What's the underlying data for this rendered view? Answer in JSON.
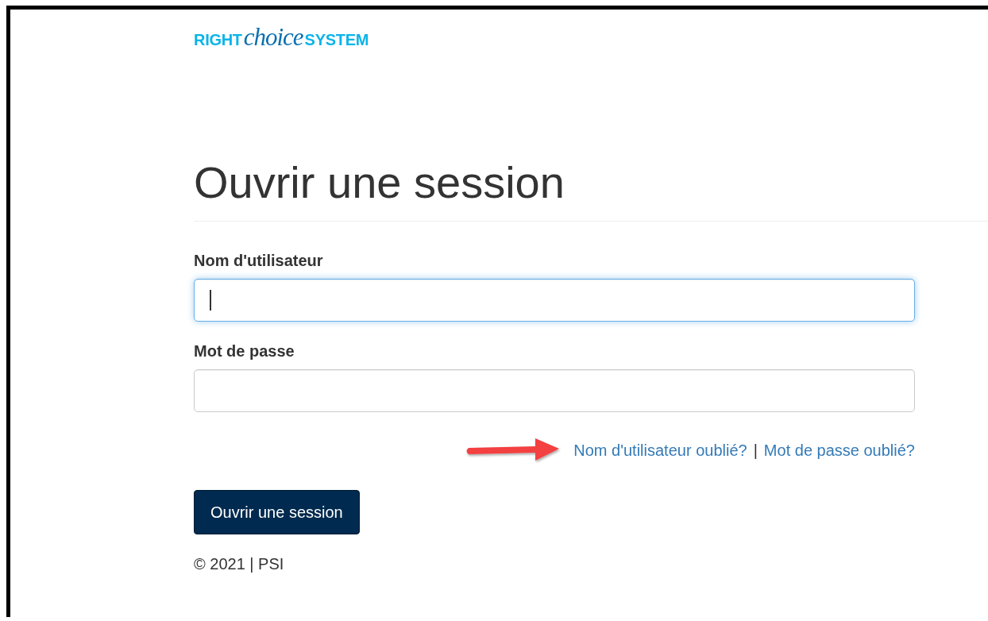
{
  "logo": {
    "part_1": "RIGHT",
    "part_2": "choice",
    "part_3": "SYSTEM"
  },
  "heading": "Ouvrir une session",
  "fields": [
    {
      "label": "Nom d'utilisateur",
      "focused": true
    },
    {
      "label": "Mot de passe",
      "focused": false
    }
  ],
  "links": [
    "Nom d'utilisateur oublié?",
    "Mot de passe oublié?"
  ],
  "link_separator": "|",
  "submit_button": "Ouvrir une session",
  "footer": "© 2021 | PSI"
}
